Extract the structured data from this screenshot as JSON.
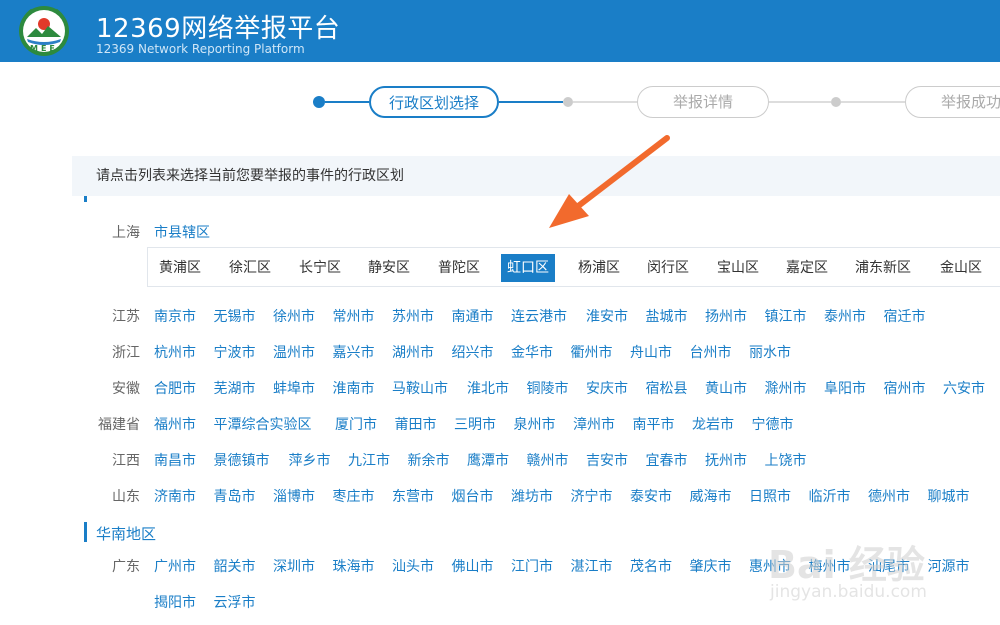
{
  "header": {
    "title": "12369网络举报平台",
    "subtitle": "12369 Network Reporting Platform",
    "logo_text": "MEE",
    "brand_color": "#1a7ec7"
  },
  "steps": [
    {
      "label": "行政区划选择",
      "state": "active"
    },
    {
      "label": "举报详情",
      "state": "inactive"
    },
    {
      "label": "举报成功",
      "state": "inactive"
    }
  ],
  "instruction": "请点击列表来选择当前您要举报的事件的行政区划",
  "shanghai": {
    "province": "上海",
    "link": "市县辖区",
    "districts": [
      "黄浦区",
      "徐汇区",
      "长宁区",
      "静安区",
      "普陀区",
      "虹口区",
      "杨浦区",
      "闵行区",
      "宝山区",
      "嘉定区",
      "浦东新区",
      "金山区"
    ],
    "selected": "虹口区"
  },
  "provinces": [
    {
      "name": "江苏",
      "cities": [
        "南京市",
        "无锡市",
        "徐州市",
        "常州市",
        "苏州市",
        "南通市",
        "连云港市",
        "淮安市",
        "盐城市",
        "扬州市",
        "镇江市",
        "泰州市",
        "宿迁市"
      ]
    },
    {
      "name": "浙江",
      "cities": [
        "杭州市",
        "宁波市",
        "温州市",
        "嘉兴市",
        "湖州市",
        "绍兴市",
        "金华市",
        "衢州市",
        "舟山市",
        "台州市",
        "丽水市"
      ]
    },
    {
      "name": "安徽",
      "cities": [
        "合肥市",
        "芜湖市",
        "蚌埠市",
        "淮南市",
        "马鞍山市",
        "淮北市",
        "铜陵市",
        "安庆市",
        "宿松县",
        "黄山市",
        "滁州市",
        "阜阳市",
        "宿州市",
        "六安市"
      ]
    },
    {
      "name": "福建省",
      "cities": [
        "福州市",
        "平潭综合实验区",
        "厦门市",
        "莆田市",
        "三明市",
        "泉州市",
        "漳州市",
        "南平市",
        "龙岩市",
        "宁德市"
      ]
    },
    {
      "name": "江西",
      "cities": [
        "南昌市",
        "景德镇市",
        "萍乡市",
        "九江市",
        "新余市",
        "鹰潭市",
        "赣州市",
        "吉安市",
        "宜春市",
        "抚州市",
        "上饶市"
      ]
    },
    {
      "name": "山东",
      "cities": [
        "济南市",
        "青岛市",
        "淄博市",
        "枣庄市",
        "东营市",
        "烟台市",
        "潍坊市",
        "济宁市",
        "泰安市",
        "威海市",
        "日照市",
        "临沂市",
        "德州市",
        "聊城市"
      ]
    }
  ],
  "south_region": {
    "title": "华南地区",
    "province": "广东",
    "row1": [
      "广州市",
      "韶关市",
      "深圳市",
      "珠海市",
      "汕头市",
      "佛山市",
      "江门市",
      "湛江市",
      "茂名市",
      "肇庆市",
      "惠州市",
      "梅州市",
      "汕尾市",
      "河源市"
    ],
    "row2": [
      "揭阳市",
      "云浮市"
    ]
  },
  "watermark": {
    "line1": "Bai 经验",
    "line2": "jingyan.baidu.com"
  }
}
